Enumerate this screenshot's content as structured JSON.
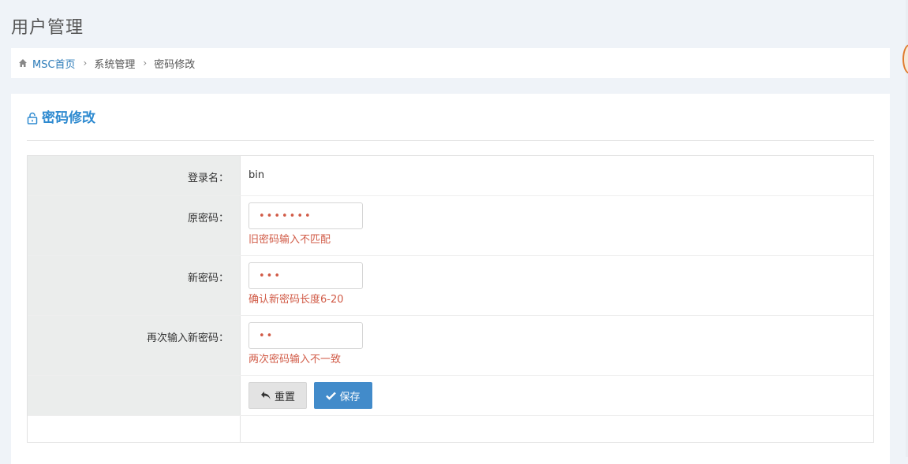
{
  "page": {
    "title": "用户管理"
  },
  "breadcrumb": {
    "home": "MSC首页",
    "items": [
      "系统管理",
      "密码修改"
    ]
  },
  "panel": {
    "title": "密码修改",
    "fields": {
      "login_name_label": "登录名：",
      "login_name_value": "bin",
      "old_password_label": "原密码：",
      "old_password_value": "•••••••",
      "old_password_error": "旧密码输入不匹配",
      "new_password_label": "新密码：",
      "new_password_value": "•••",
      "new_password_error": "确认新密码长度6-20",
      "confirm_password_label": "再次输入新密码：",
      "confirm_password_value": "••",
      "confirm_password_error": "两次密码输入不一致"
    },
    "buttons": {
      "reset": "重置",
      "save": "保存"
    }
  },
  "colors": {
    "accent": "#2e8ad0",
    "error": "#d15b47",
    "save_button": "#428bca"
  }
}
